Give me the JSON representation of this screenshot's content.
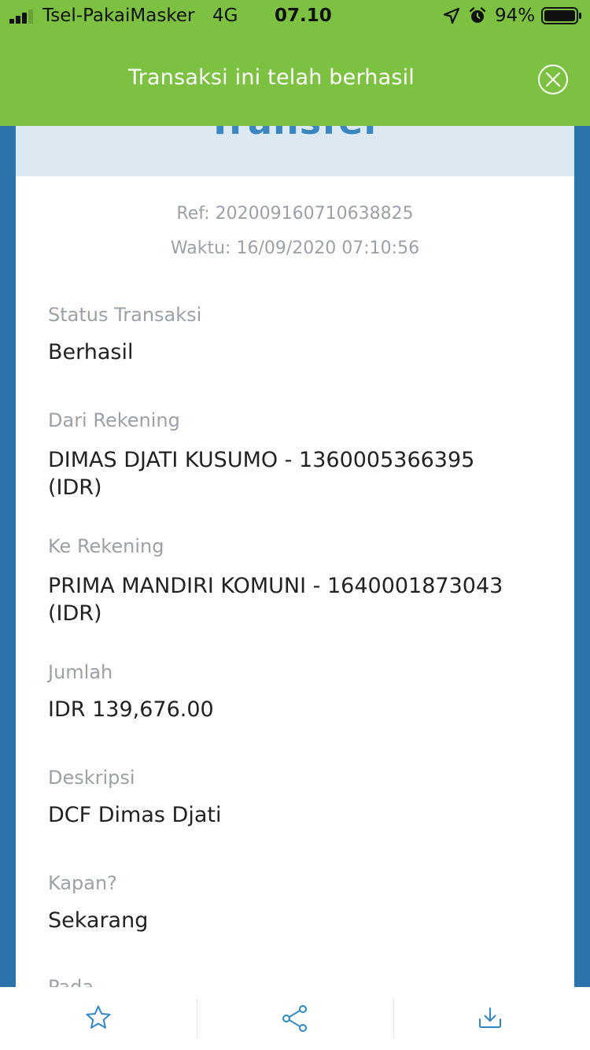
{
  "status_bar": {
    "carrier": "Tsel-PakaiMasker",
    "network": "4G",
    "time": "07.10",
    "battery": "94%"
  },
  "banner": {
    "message": "Transaksi ini telah berhasil",
    "close_icon": "close-circle-icon"
  },
  "card_header": {
    "title": "Transfer"
  },
  "meta": {
    "ref": "Ref: 202009160710638825",
    "time": "Waktu: 16/09/2020 07:10:56"
  },
  "details": {
    "status": {
      "label": "Status Transaksi",
      "value": "Berhasil"
    },
    "from": {
      "label": "Dari Rekening",
      "value_line1": "DIMAS DJATI KUSUMO - 1360005366395",
      "value_line2": "(IDR)"
    },
    "to": {
      "label": "Ke Rekening",
      "value_line1": "PRIMA MANDIRI KOMUNI - 1640001873043",
      "value_line2": "(IDR)"
    },
    "amount": {
      "label": "Jumlah",
      "value": "IDR 139,676.00"
    },
    "description": {
      "label": "Deskripsi",
      "value": "DCF Dimas Djati"
    },
    "when": {
      "label": "Kapan?",
      "value": "Sekarang"
    },
    "on": {
      "label": "Pada"
    }
  },
  "bottom_bar": {
    "icons": [
      "star-icon",
      "share-icon",
      "download-icon"
    ],
    "icon_color": "#2f86c8"
  },
  "colors": {
    "banner": "#7dc142",
    "frame": "#2b73ab",
    "header": "#dce8f2",
    "label": "#9aa1a8",
    "value": "#222222"
  }
}
